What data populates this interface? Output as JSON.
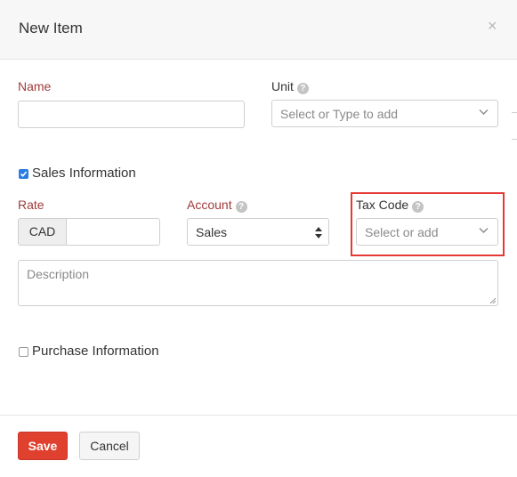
{
  "dialog": {
    "title": "New Item",
    "close_glyph": "×"
  },
  "name": {
    "label": "Name",
    "value": ""
  },
  "unit": {
    "label": "Unit",
    "placeholder": "Select or Type to add"
  },
  "sales_info": {
    "label": "Sales Information",
    "checked": true
  },
  "rate": {
    "label": "Rate",
    "currency": "CAD",
    "value": ""
  },
  "account": {
    "label": "Account",
    "value": "Sales"
  },
  "tax_code": {
    "label": "Tax Code",
    "placeholder": "Select or add"
  },
  "description": {
    "placeholder": "Description"
  },
  "purchase_info": {
    "label": "Purchase Information",
    "checked": false
  },
  "buttons": {
    "save": "Save",
    "cancel": "Cancel"
  },
  "icons": {
    "help": "?",
    "close": "close-icon",
    "chevron": "chevron-down-icon",
    "sort": "sort-arrows-icon"
  },
  "colors": {
    "required_label": "#a23b3b",
    "save_button": "#e0412f",
    "highlight": "#e53935",
    "checkbox": "#2b7de1"
  }
}
